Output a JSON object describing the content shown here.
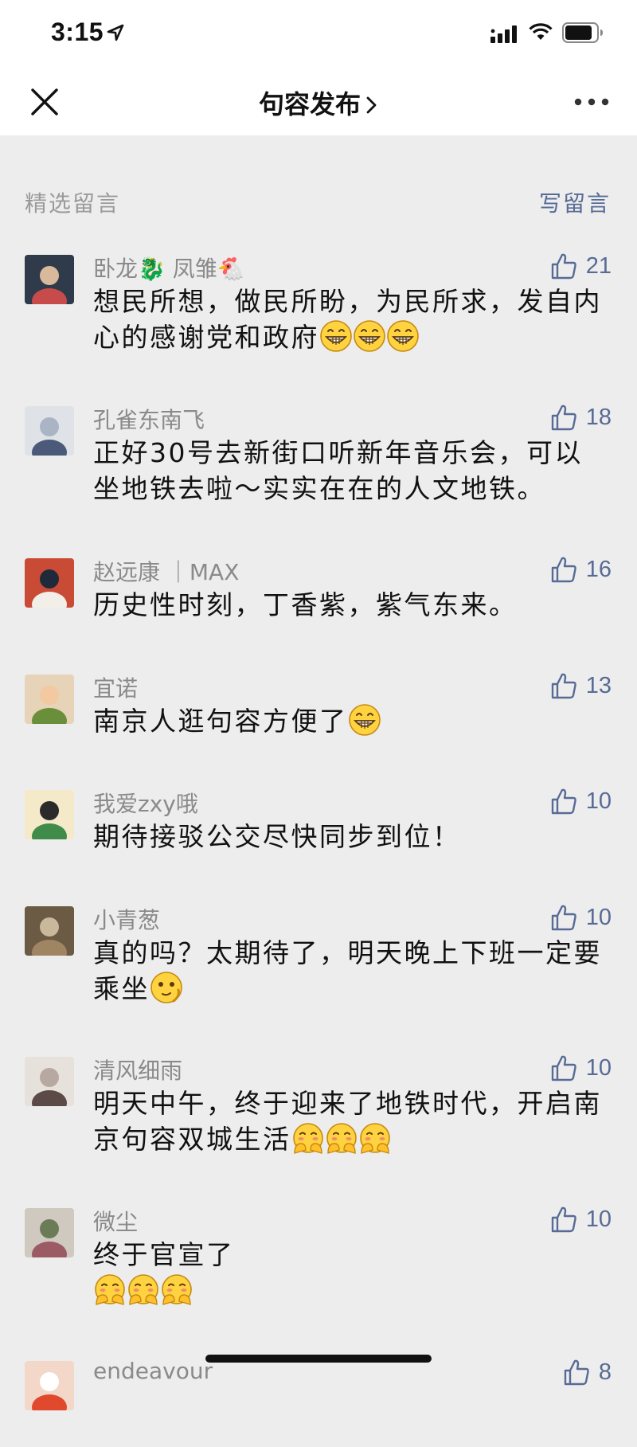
{
  "status": {
    "time": "3:15"
  },
  "nav": {
    "title": "句容发布"
  },
  "section": {
    "title": "精选留言",
    "write_label": "写留言"
  },
  "comments": [
    {
      "nick": "卧龙🐉 凤雏🐔",
      "likes": "21",
      "text": "想民所想，做民所盼，为民所求，发自内心的感谢党和政府",
      "emoji": "grin",
      "emoji_count": 3
    },
    {
      "nick": "孔雀东南飞",
      "likes": "18",
      "text": "正好30号去新街口听新年音乐会，可以坐地铁去啦～实实在在的人文地铁。"
    },
    {
      "nick": "赵远康 ｜MAX",
      "likes": "16",
      "text": "历史性时刻，丁香紫，紫气东来。"
    },
    {
      "nick": "宜诺",
      "likes": "13",
      "text": "南京人逛句容方便了",
      "emoji": "grin",
      "emoji_count": 1
    },
    {
      "nick": "我爱zxy哦",
      "likes": "10",
      "text": "期待接驳公交尽快同步到位！"
    },
    {
      "nick": "小青葱",
      "likes": "10",
      "text": "真的吗？太期待了，明天晚上下班一定要乘坐",
      "emoji": "wink",
      "emoji_count": 1
    },
    {
      "nick": "清风细雨",
      "likes": "10",
      "text": "明天中午，终于迎来了地铁时代，开启南京句容双城生活",
      "emoji": "shy",
      "emoji_count": 3
    },
    {
      "nick": "微尘",
      "likes": "10",
      "text": "终于官宣了",
      "emoji": "shy",
      "emoji_count": 3,
      "emoji_newline": true
    },
    {
      "nick": "endeavour",
      "likes": "8",
      "text": ""
    }
  ]
}
